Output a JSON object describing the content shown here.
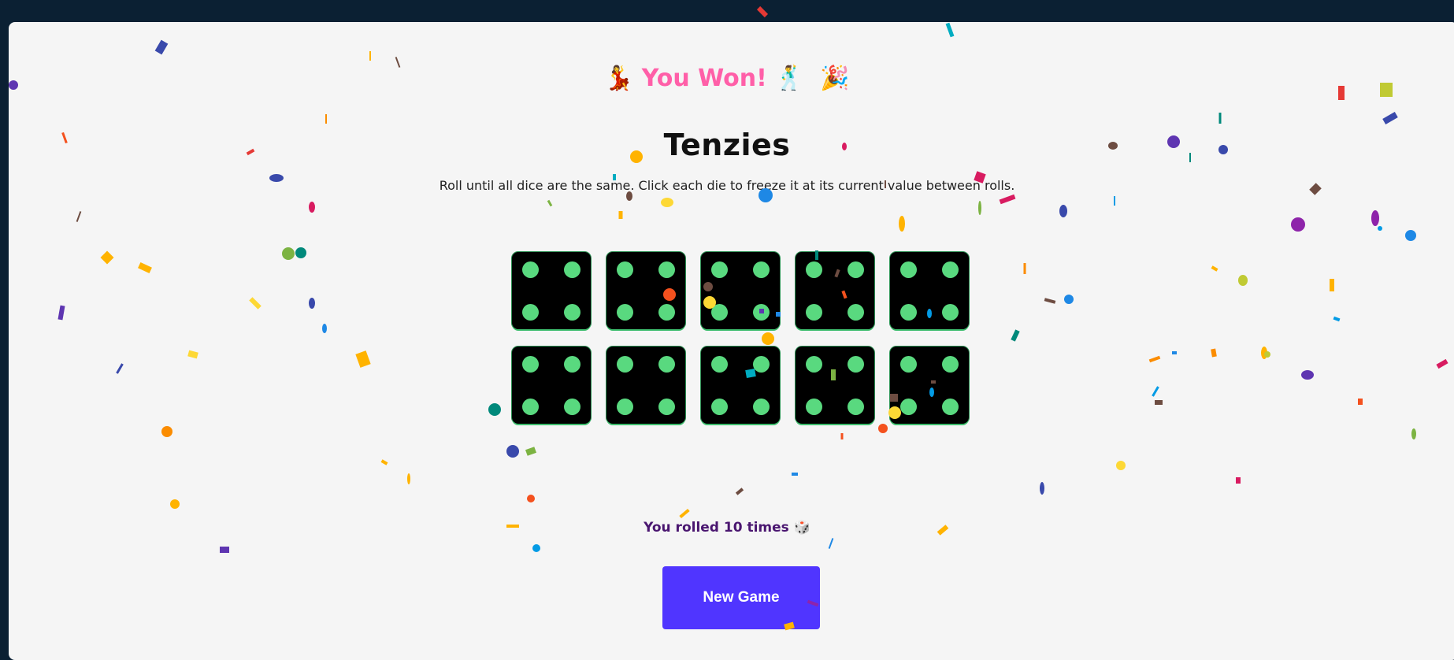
{
  "banner": {
    "left_emoji": "💃",
    "text": "You Won!",
    "right_emoji_1": "🕺",
    "right_emoji_2": "🎉"
  },
  "title": "Tenzies",
  "instructions": "Roll until all dice are the same. Click each die to freeze it at its current value between rolls.",
  "dice": [
    {
      "value": 4,
      "held": true
    },
    {
      "value": 4,
      "held": true
    },
    {
      "value": 4,
      "held": true
    },
    {
      "value": 4,
      "held": true
    },
    {
      "value": 4,
      "held": true
    },
    {
      "value": 4,
      "held": true
    },
    {
      "value": 4,
      "held": true
    },
    {
      "value": 4,
      "held": true
    },
    {
      "value": 4,
      "held": true
    },
    {
      "value": 4,
      "held": true
    }
  ],
  "roll_count_text": "You rolled 10 times 🎲",
  "new_game_label": "New Game",
  "colors": {
    "background": "#0b2033",
    "board": "#f5f5f5",
    "die_face": "#000000",
    "pip": "#59d97f",
    "button": "#5035ff",
    "banner_text": "#ff5fa8",
    "roll_text": "#4a1670"
  }
}
